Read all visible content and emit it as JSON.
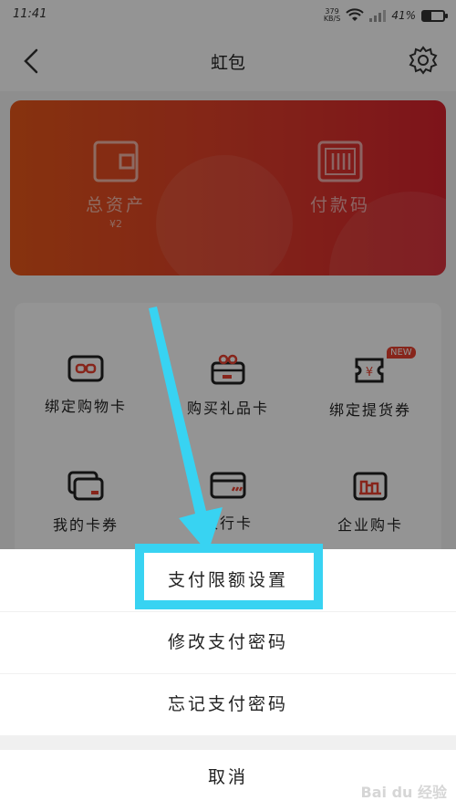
{
  "status": {
    "time": "11:41",
    "net_speed": "379",
    "net_unit": "KB/S",
    "battery": "41%",
    "battery_level": 0.41
  },
  "nav": {
    "title": "虹包"
  },
  "card": {
    "assets_label": "总资产",
    "assets_value": "¥2",
    "paycode_label": "付款码"
  },
  "grid": {
    "items": [
      {
        "label": "绑定购物卡",
        "icon": "link-card-icon"
      },
      {
        "label": "购买礼品卡",
        "icon": "gift-card-icon"
      },
      {
        "label": "绑定提货券",
        "icon": "voucher-icon",
        "badge": "NEW"
      },
      {
        "label": "我的卡券",
        "icon": "cards-icon"
      },
      {
        "label": "银行卡",
        "icon": "bank-card-icon"
      },
      {
        "label": "企业购卡",
        "icon": "enterprise-card-icon"
      }
    ]
  },
  "sheet": {
    "options": [
      "支付限额设置",
      "修改支付密码",
      "忘记支付密码"
    ],
    "cancel": "取消"
  },
  "colors": {
    "highlight": "#38d3f2",
    "card_start": "#e8571a",
    "card_end": "#d8232e",
    "badge": "#e8412f"
  },
  "watermark": "Bai du 经验"
}
